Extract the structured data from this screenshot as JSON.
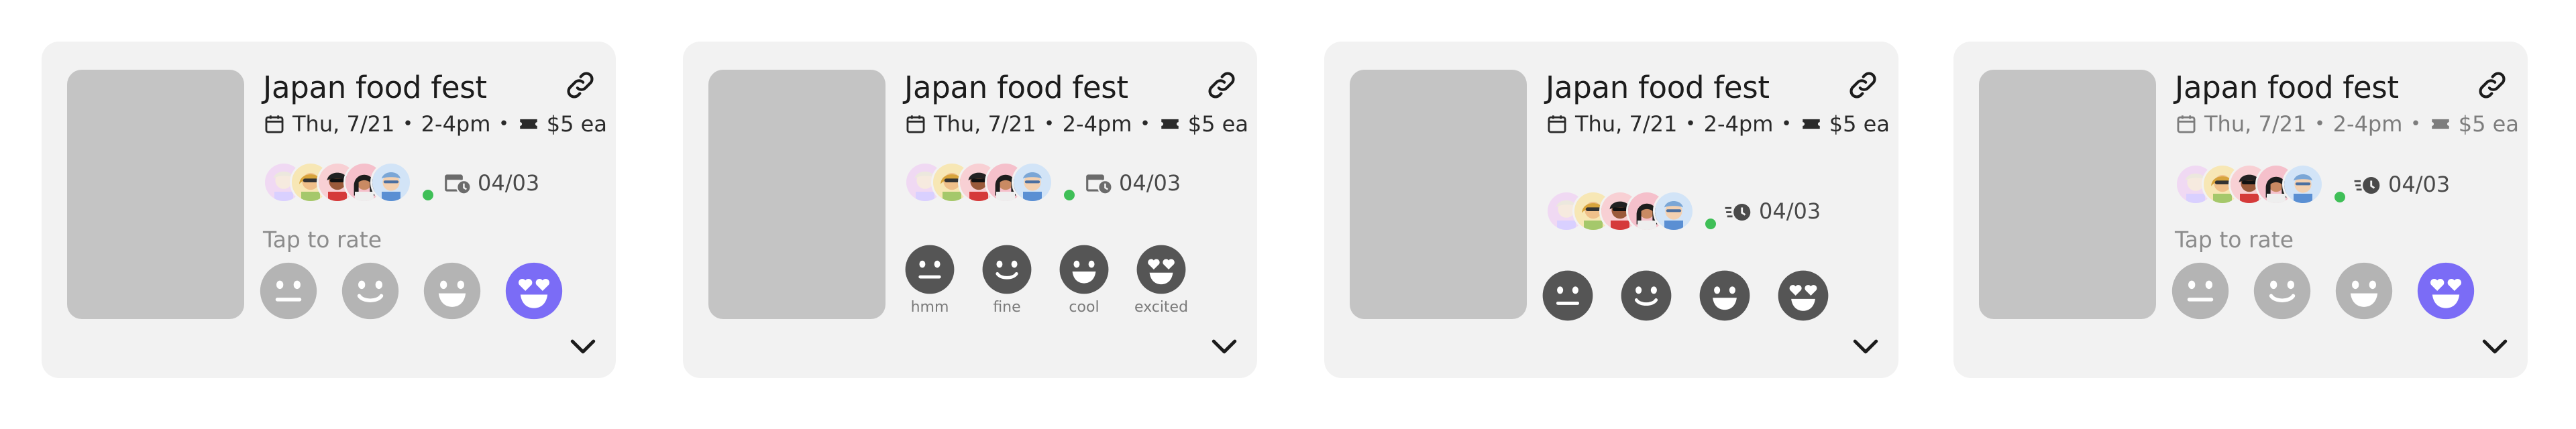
{
  "cards": [
    {
      "title": "Japan food fest",
      "date_label": "Thu, 7/21",
      "time_label": "2-4pm",
      "price_label": "$5 ea",
      "deadline": "04/03",
      "rate_label": "Tap to rate",
      "faces": [
        "neutral",
        "smile",
        "grin",
        "love"
      ],
      "selected_face": "love"
    },
    {
      "title": "Japan food fest",
      "date_label": "Thu, 7/21",
      "time_label": "2-4pm",
      "price_label": "$5 ea",
      "deadline": "04/03",
      "face_captions": [
        "hmm",
        "fine",
        "cool",
        "excited"
      ]
    },
    {
      "title": "Japan food fest",
      "date_label": "Thu, 7/21",
      "time_label": "2-4pm",
      "price_label": "$5 ea",
      "deadline": "04/03"
    },
    {
      "title": "Japan food fest",
      "date_label": "Thu, 7/21",
      "time_label": "2-4pm",
      "price_label": "$5 ea",
      "deadline": "04/03",
      "rate_label": "Tap to rate",
      "selected_face": "love"
    }
  ],
  "colors": {
    "card_bg": "#f2f2f2",
    "thumbnail": "#c4c4c4",
    "face_inactive": "#b4b4b4",
    "face_dark": "#555555",
    "face_selected": "#7b6cf6",
    "online": "#3fbf57"
  },
  "icons": [
    "calendar-icon",
    "ticket-icon",
    "link-icon",
    "calendar-clock-icon",
    "clock-speed-icon",
    "chevron-down-icon"
  ]
}
